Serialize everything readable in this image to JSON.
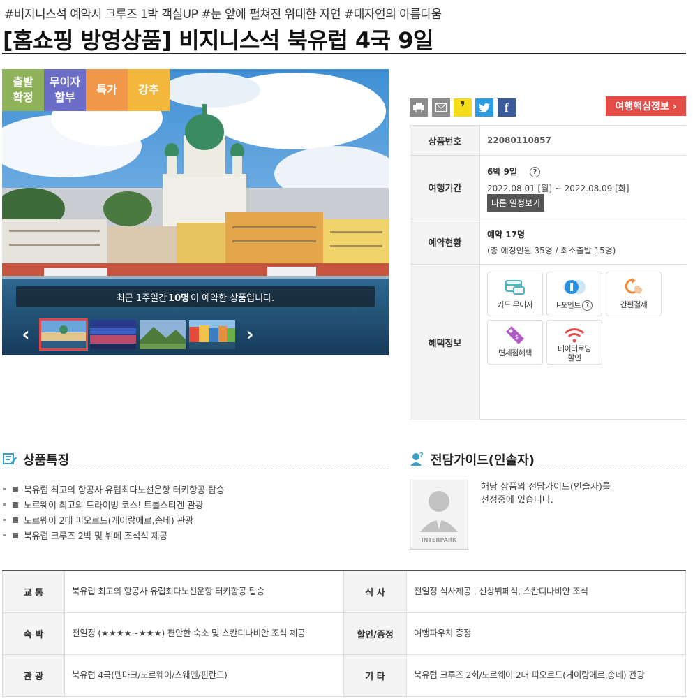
{
  "hashtags": "#비지니스석 예약시 크루즈 1박 객실UP #눈 앞에 펼쳐진 위대한 자연 #대자연의 아름다움",
  "title": "[홈쇼핑 방영상품] 비지니스석 북유럽 4국 9일",
  "gallery": {
    "badges": [
      {
        "label": "출발\n확정",
        "color": "#8fb35a"
      },
      {
        "label": "무이자\n할부",
        "color": "#6c6cc9"
      },
      {
        "label": "특가",
        "color": "#f0974a"
      },
      {
        "label": "강추",
        "color": "#f3b73b"
      }
    ],
    "recent_prefix": "최근 1주일간 ",
    "recent_count": "10명",
    "recent_suffix": "이 예약한 상품입니다.",
    "prev_arrow": "‹",
    "next_arrow": "›"
  },
  "share": {
    "print_icon": "printer-icon",
    "mail_icon": "mail-icon",
    "kakao_icon": "kakao-icon",
    "twitter_icon": "twitter-icon",
    "facebook_icon": "facebook-icon",
    "kakao_glyph": "❜",
    "facebook_glyph": "f",
    "key_info_label": "여행핵심정보 ›"
  },
  "info": {
    "product_no_label": "상품번호",
    "product_no": "22080110857",
    "period_label": "여행기간",
    "period_duration": "6박 9일",
    "period_help": "?",
    "period_dates": "2022.08.01 [월] ~ 2022.08.09 [화]",
    "other_schedule": "다른 일정보기",
    "booking_label": "예약현황",
    "booking_count": "예약 17명",
    "booking_detail": "(총 예정인원 35명 / 최소출발 15명)",
    "benefit_label": "혜택정보",
    "benefits": [
      {
        "label": "카드 무이자",
        "icon": "card-icon"
      },
      {
        "label": "I-포인트",
        "icon": "i-point-icon"
      },
      {
        "label": "간편결제",
        "icon": "easy-pay-icon"
      },
      {
        "label": "면세점혜택",
        "icon": "duty-free-tag-icon"
      },
      {
        "label": "데이터로밍\n할인",
        "icon": "wifi-icon"
      }
    ]
  },
  "features": {
    "title": "상품특징",
    "items": [
      "북유럽 최고의 항공사 유럽최다노선운항 터키항공 탑승",
      "노르웨이 최고의 드라이빙 코스! 트롤스티겐 관광",
      "노르웨이 2대 피오르드(게이랑에르,송네) 관광",
      "북유럽 크루즈 2박 및 뷔페 조석식 제공"
    ]
  },
  "guide": {
    "title": "전담가이드(인솔자)",
    "text_line1": "해당 상품의 전담가이드(인솔자)를",
    "text_line2": "선정중에 있습니다.",
    "photo_brand": "INTERPARK"
  },
  "summary": [
    {
      "h1": "교 통",
      "v1": "북유럽 최고의 항공사 유럽최다노선운항 터키항공 탑승",
      "h2": "식 사",
      "v2": "전일정 식사제공 , 선상뷔페식, 스칸디나비안 조식"
    },
    {
      "h1": "숙 박",
      "v1": "전일정 (★★★★~★★★) 편안한 숙소 및 스칸디나비안 조식 제공",
      "h2": "할인/증정",
      "v2": "여행파우치 증정"
    },
    {
      "h1": "관 광",
      "v1": "북유럽 4국(덴마크/노르웨이/스웨덴/핀란드)",
      "h2": "기 타",
      "v2": "북유럽 크루즈 2회/노르웨이 2대 피오르드(게이랑에르,송네) 관광"
    }
  ]
}
